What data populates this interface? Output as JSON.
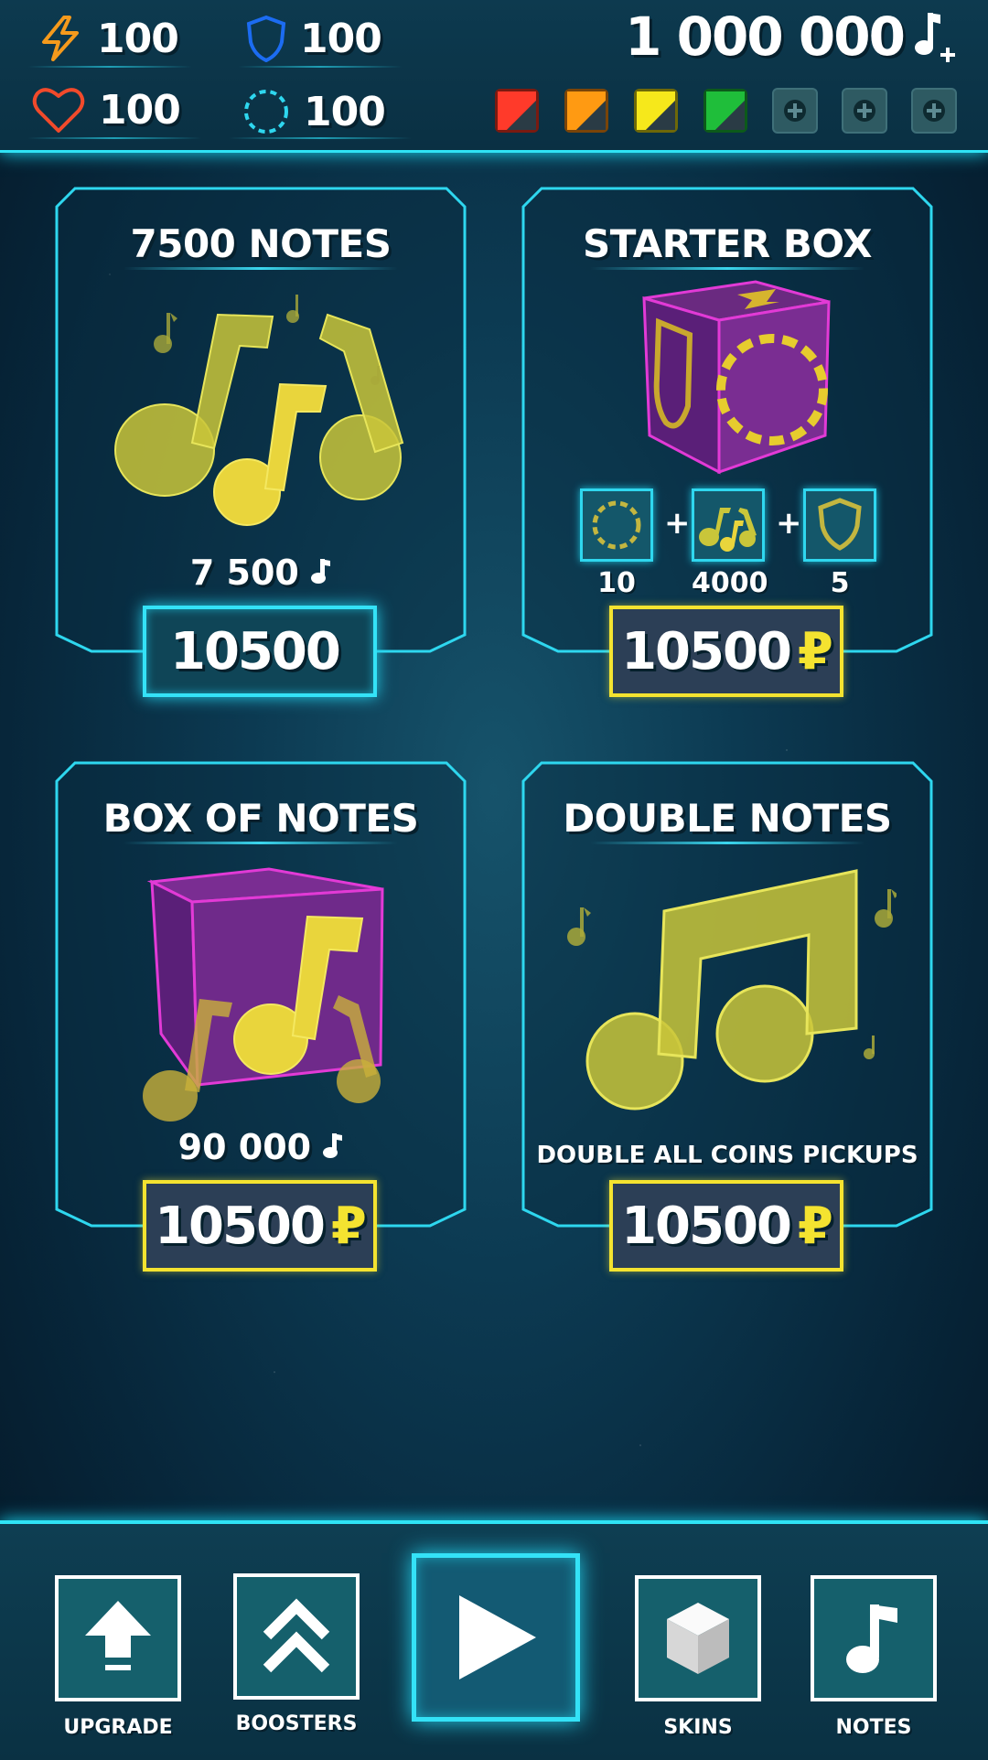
{
  "stats": {
    "energy": {
      "icon": "lightning-icon",
      "value": "100"
    },
    "shield": {
      "icon": "shield-icon",
      "value": "100"
    },
    "health": {
      "icon": "heart-icon",
      "value": "100"
    },
    "magnet": {
      "icon": "dashed-ring-icon",
      "value": "100"
    }
  },
  "currency": {
    "value": "1 000 000",
    "icon": "music-note-plus-icon"
  },
  "gems": [
    {
      "color": "#ff3a2a",
      "name": "red-gem-icon"
    },
    {
      "color": "#ff9a12",
      "name": "orange-gem-icon"
    },
    {
      "color": "#f6e81b",
      "name": "yellow-gem-icon"
    },
    {
      "color": "#1fbe3a",
      "name": "green-gem-icon"
    }
  ],
  "gem_slots": [
    "plus-icon",
    "plus-icon",
    "plus-icon"
  ],
  "cards": {
    "notes7500": {
      "title": "7500 NOTES",
      "amount": "7 500",
      "price": "10500"
    },
    "starter": {
      "title": "STARTER BOX",
      "items": [
        {
          "icon": "dashed-ring-icon",
          "value": "10"
        },
        {
          "icon": "music-notes-icon",
          "value": "4000"
        },
        {
          "icon": "shield-icon",
          "value": "5"
        }
      ],
      "plus_sign": "+",
      "price": "10500",
      "currency_sign": "₽"
    },
    "box_of_notes": {
      "title": "BOX OF NOTES",
      "amount": "90 000",
      "price": "10500",
      "currency_sign": "₽"
    },
    "double_notes": {
      "title": "DOUBLE  NOTES",
      "description": "DOUBLE ALL COINS PICKUPS",
      "price": "10500",
      "currency_sign": "₽"
    }
  },
  "nav": {
    "upgrade": "UPGRADE",
    "boosters": "BOOSTERS",
    "skins": "SKINS",
    "notes": "NOTES"
  },
  "colors": {
    "accent_cyan": "#2fe3f5",
    "note_yellow": "#e6d43a",
    "box_magenta": "#e23ad6",
    "price_yellow": "#f4e330"
  }
}
